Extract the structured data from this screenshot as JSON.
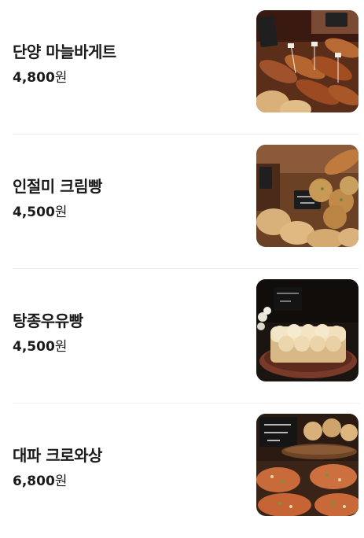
{
  "menu": {
    "items": [
      {
        "name": "단양 마늘바게트",
        "price": "4,800",
        "currency": "원",
        "image_icon": "garlic-baguette-photo",
        "image_sign_text": "단양마늘바게트"
      },
      {
        "name": "인절미 크림빵",
        "price": "4,500",
        "currency": "원",
        "image_icon": "injeolmi-cream-bread-photo",
        "image_sign_text": "인절미크림빵 4.5"
      },
      {
        "name": "탕종우유빵",
        "price": "4,500",
        "currency": "원",
        "image_icon": "milk-bread-photo",
        "image_sign_text": "탕종우유빵 4.5"
      },
      {
        "name": "대파 크로와상",
        "price": "6,800",
        "currency": "원",
        "image_icon": "green-onion-croissant-photo",
        "image_sign_text": "대파 크로와상 6.8"
      }
    ]
  },
  "colors": {
    "text": "#1a1a1a",
    "divider": "#eeeeee",
    "background": "#ffffff"
  }
}
